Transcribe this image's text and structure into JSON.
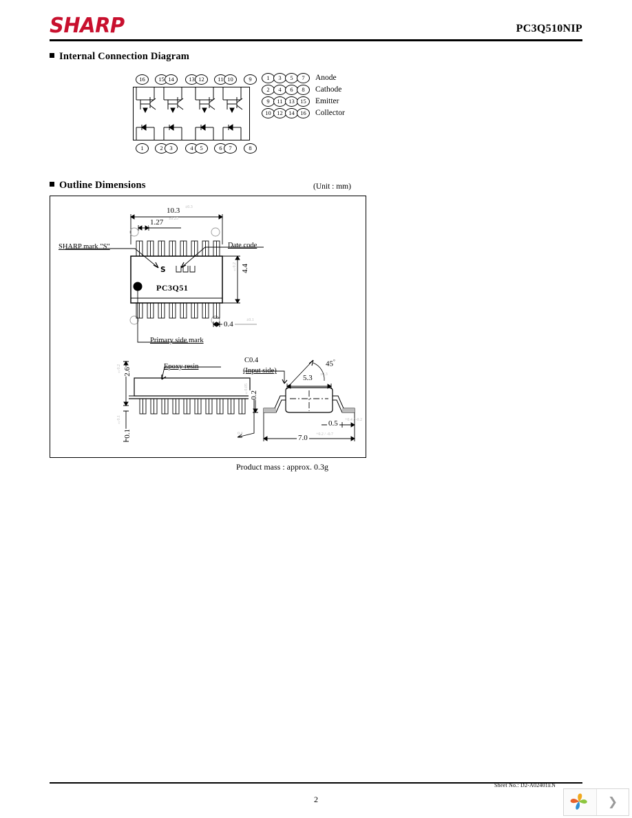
{
  "header": {
    "logo_text": "SHARP",
    "logo_color": "#c8102e",
    "part_number": "PC3Q510NIP"
  },
  "sections": {
    "internal_connection": {
      "title": "Internal Connection Diagram",
      "top_pins": [
        "16",
        "15",
        "14",
        "13",
        "12",
        "11",
        "10",
        "9"
      ],
      "bottom_pins": [
        "1",
        "2",
        "3",
        "4",
        "5",
        "6",
        "7",
        "8"
      ],
      "legend": [
        {
          "pins": [
            "1",
            "3",
            "5",
            "7"
          ],
          "label": "Anode"
        },
        {
          "pins": [
            "2",
            "4",
            "6",
            "8"
          ],
          "label": "Cathode"
        },
        {
          "pins": [
            "9",
            "11",
            "13",
            "15"
          ],
          "label": "Emitter"
        },
        {
          "pins": [
            "10",
            "12",
            "14",
            "16"
          ],
          "label": "Collector"
        }
      ]
    },
    "outline_dimensions": {
      "title": "Outline Dimensions",
      "unit_note": "(Unit : mm)",
      "product_mass": "Product mass : approx. 0.3g",
      "top_view": {
        "marking": "PC3Q51",
        "width": "10.3",
        "width_tol": "±0.3",
        "pitch": "1.27",
        "pitch_tol": "±0.25",
        "body_height": "4.4",
        "body_height_tol": "±0.2",
        "lead_width": "0.4",
        "lead_width_tol": "±0.1",
        "callout_sharp_mark": "SHARP mark \"S\"",
        "callout_date_code": "Date code",
        "callout_primary_side": "Primary side mark"
      },
      "side_view": {
        "height": "2.6",
        "height_tol": "±0.2",
        "standoff": "0.1",
        "standoff_tol": "±0.1",
        "lead_thickness": "0.4",
        "callout_epoxy": "Epoxy resin"
      },
      "end_view": {
        "chamfer": "C0.4",
        "chamfer_note": "(Input side)",
        "angle": "45",
        "angle_unit": "°",
        "body_width": "5.3",
        "body_width_tol": "±0.3",
        "lead_height": "0.2",
        "lead_height_tol": "±0.05",
        "foot_length": "0.5",
        "foot_length_tol": "+0.4 / -0.2",
        "total_width": "7.0",
        "total_width_tol": "+0.2 / -0.7"
      }
    }
  },
  "footer": {
    "sheet_no": "Sheet No.: D2-A02401EN",
    "page_number": "2"
  },
  "viewer": {
    "next_page_glyph": "❯"
  }
}
